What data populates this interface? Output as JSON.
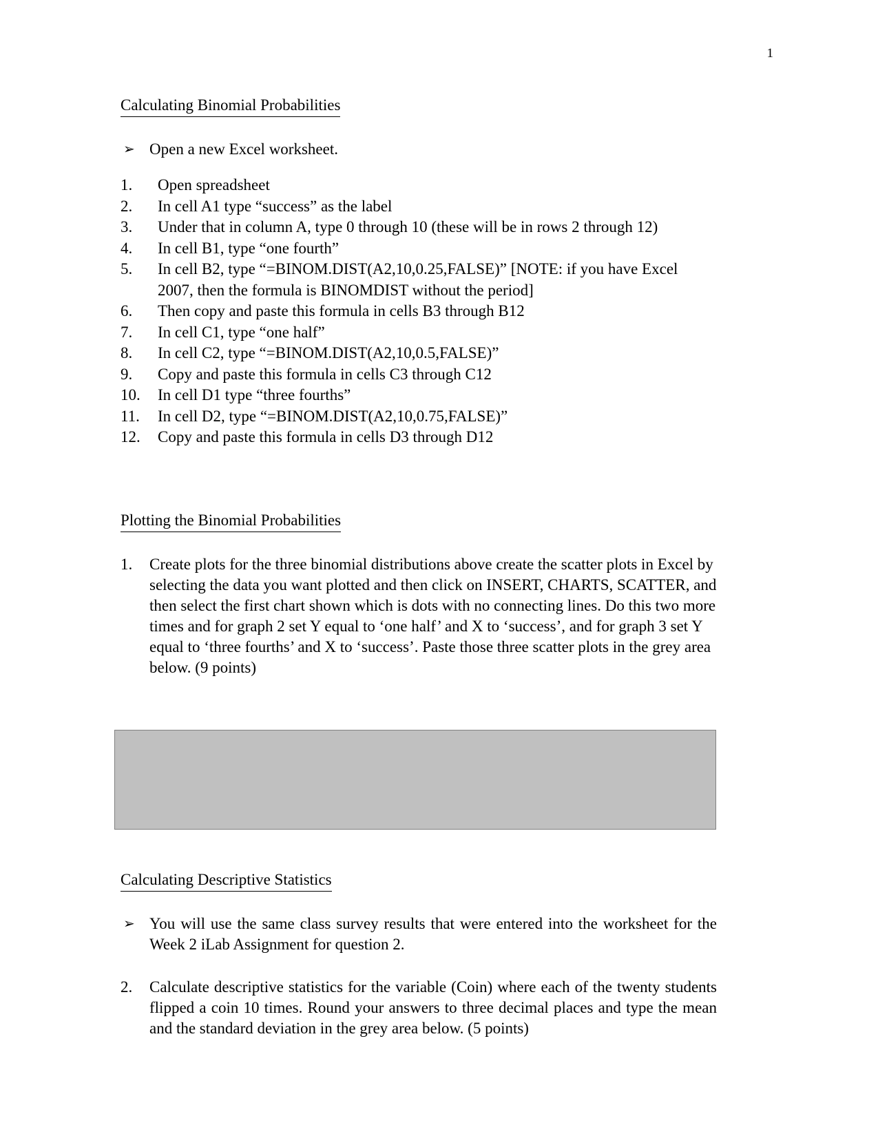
{
  "document": {
    "page_number": "1",
    "colors": {
      "text": "#000000",
      "grey_box_fill": "#c0c0c0",
      "grey_box_border": "#808080",
      "page_background": "#ffffff"
    }
  },
  "section1": {
    "heading": "Calculating Binomial Probabilities",
    "bullet_glyph": "➢",
    "intro": "Open a new Excel worksheet.",
    "steps": [
      {
        "marker": "1.",
        "text": "Open spreadsheet"
      },
      {
        "marker": "2.",
        "text": "In cell A1 type “success” as the label"
      },
      {
        "marker": "3.",
        "text": "Under that in column A, type 0 through 10 (these will be in rows 2 through 12)"
      },
      {
        "marker": "4.",
        "text": "In cell B1, type “one fourth”"
      },
      {
        "marker": "5.",
        "text": "In cell B2, type “=BINOM.DIST(A2,10,0.25,FALSE)”  [NOTE: if you have Excel 2007, then the formula is BINOMDIST without the period]"
      },
      {
        "marker": "6.",
        "text": "Then copy and paste this formula in cells B3 through B12"
      },
      {
        "marker": "7.",
        "text": "In cell C1, type “one half”"
      },
      {
        "marker": "8.",
        "text": "In cell C2, type “=BINOM.DIST(A2,10,0.5,FALSE)”"
      },
      {
        "marker": "9.",
        "text": "Copy and paste this formula in cells C3 through C12"
      },
      {
        "marker": "10.",
        "text": "In cell D1 type “three fourths”"
      },
      {
        "marker": "11.",
        "text": "In cell D2, type “=BINOM.DIST(A2,10,0.75,FALSE)”"
      },
      {
        "marker": "12.",
        "text": "Copy and paste this formula in cells D3 through D12"
      }
    ]
  },
  "section2": {
    "heading": "Plotting the Binomial Probabilities",
    "item": {
      "marker": "1.",
      "text": "Create plots for the three binomial distributions above create the scatter plots in Excel by selecting the data you want plotted and then click on INSERT, CHARTS, SCATTER, and then select the first chart shown which is dots with no connecting lines.  Do this two more times and for graph 2 set Y equal to ‘one half’ and X to ‘success’, and for graph 3 set Y equal to ‘three fourths’ and X to ‘success’.  Paste those three scatter plots in the grey area below.  (9 points)"
    },
    "answer_area_label": "grey answer area for scatter plots"
  },
  "section3": {
    "heading": "Calculating Descriptive Statistics",
    "bullet_glyph": "➢",
    "bullet_text": "You will use the same class survey results that were entered into the worksheet for the Week 2 iLab Assignment for question 2.",
    "item": {
      "marker": "2.",
      "text": "Calculate descriptive statistics for the variable (Coin) where each of the twenty students flipped a coin 10 times. Round your answers to three decimal places and type the mean and the standard deviation in the grey area below.  (5 points)"
    }
  }
}
